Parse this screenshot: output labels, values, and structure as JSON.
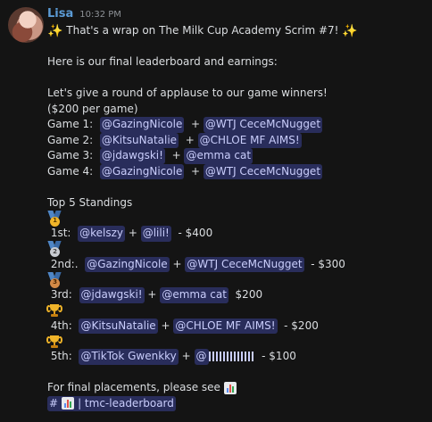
{
  "user": {
    "name": "Lisa",
    "time": "10:32 PM"
  },
  "message": {
    "headline": "That's a wrap on The Milk Cup Academy Scrim #7!",
    "intro": "Here is our final leaderboard and earnings:",
    "applause": "Let's give a round of applause to our game winners!",
    "prize_note": "($200 per game)",
    "games": [
      {
        "label": "Game 1:",
        "p1": "@GazingNicole",
        "sep": "+",
        "p2": "@WTJ CeceMcNugget"
      },
      {
        "label": "Game 2:",
        "p1": "@KitsuNatalie",
        "sep": "+",
        "p2": "@CHLOE MF AIMS!"
      },
      {
        "label": "Game 3:",
        "p1": "@jdawgski!",
        "sep": "+",
        "p2": "@emma cat"
      },
      {
        "label": "Game 4:",
        "p1": "@GazingNicole",
        "sep": "+",
        "p2": "@WTJ CeceMcNugget"
      }
    ],
    "standings_title": "Top 5 Standings",
    "standings": [
      {
        "medal": "gold",
        "medal_num": "1",
        "place": "1st:",
        "p1": "@kelszy",
        "sep": "+",
        "p2": "@lili!",
        "prize": "- $400"
      },
      {
        "medal": "silver",
        "medal_num": "2",
        "place": "2nd:.",
        "p1": "@GazingNicole",
        "sep": "+",
        "p2": "@WTJ CeceMcNugget",
        "prize": "- $300"
      },
      {
        "medal": "bronze",
        "medal_num": "3",
        "place": "3rd:",
        "p1": "@jdawgski!",
        "sep": "+",
        "p2": "@emma cat",
        "prize": "$200"
      },
      {
        "medal": "trophy",
        "place": "4th:",
        "p1": "@KitsuNatalie",
        "sep": "+",
        "p2": "@CHLOE MF AIMS!",
        "prize": "- $200"
      },
      {
        "medal": "trophy",
        "place": "5th:",
        "p1": "@TikTok Gwenkky",
        "sep": "+",
        "p2": "@",
        "prize": "- $100"
      }
    ],
    "final_note": "For final placements, please see",
    "channel": {
      "hash": "#",
      "name": "| tmc-leaderboard"
    }
  },
  "icons": {
    "sparkle": "sparkles-icon",
    "chart": "bar-chart-icon",
    "medal": "medal-icon",
    "trophy": "trophy-icon"
  }
}
